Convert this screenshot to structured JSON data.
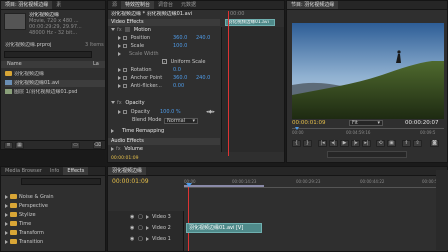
{
  "project": {
    "tabs": [
      "项目: 羽化视频边缘",
      "素"
    ],
    "clip_title": "羽化视频边缘",
    "clip_info": [
      "Movie, 720 x 480 ...",
      "00:00:29:29, 29.97...",
      "48000 Hz - 32 bit..."
    ],
    "project_file": "羽化视频边缘.prproj",
    "items_count": "3 Items",
    "column_name": "Name",
    "column_label": "La",
    "items": [
      {
        "name": "羽化视频边缘",
        "type": "folder"
      },
      {
        "name": "羽化视频边缘01.avi",
        "type": "clip"
      },
      {
        "name": "图层 1/羽化视频边缘01.psd",
        "type": "image"
      }
    ]
  },
  "effect_controls": {
    "tabs": [
      "源",
      "特效控制台",
      "调音台",
      "元数据"
    ],
    "sequence_clip": "羽化视频边缘 * 羽化视频边缘01.avi",
    "timecode_head": "00:00",
    "clip_chip": "羽化视频边缘01.avi",
    "section_video": "Video Effects",
    "motion": "Motion",
    "position_label": "Position",
    "position_x": "360.0",
    "position_y": "240.0",
    "scale_label": "Scale",
    "scale_value": "100.0",
    "scale_width_label": "Scale Width",
    "uniform_scale": "Uniform Scale",
    "rotation_label": "Rotation",
    "rotation_value": "0.0",
    "anchor_label": "Anchor Point",
    "anchor_x": "360.0",
    "anchor_y": "240.0",
    "antiflicker_label": "Anti-flicker...",
    "antiflicker_value": "0.00",
    "opacity_section": "Opacity",
    "opacity_label": "Opacity",
    "opacity_value": "100.0 %",
    "blend_label": "Blend Mode",
    "blend_value": "Normal",
    "time_remapping": "Time Remapping",
    "section_audio": "Audio Effects",
    "volume": "Volume",
    "footer_timecode": "00:00:01:09"
  },
  "program": {
    "tabs": [
      "节目: 羽化视频边缘"
    ],
    "timecode": "00:00:01:09",
    "fit": "Fit",
    "duration": "00:00:20:07",
    "ruler_start": "00:00",
    "ruler_mid": "00:04:59:16",
    "ruler_end": "00:09:5"
  },
  "effects": {
    "tabs": [
      "Media Browser",
      "Info",
      "Effects"
    ],
    "items": [
      "Noise & Grain",
      "Perspective",
      "Stylize",
      "Time",
      "Transform",
      "Transition"
    ]
  },
  "timeline": {
    "tabs": [
      "羽化视频边缘"
    ],
    "timecode": "00:00:01:09",
    "ruler": [
      "00:00",
      "00:00:14:23",
      "00:00:29:23",
      "00:00:44:22",
      "00:00:59:22"
    ],
    "tracks": [
      {
        "name": "Video 3",
        "clip": ""
      },
      {
        "name": "Video 2",
        "clip": "羽化视频边缘01.avi [V]"
      },
      {
        "name": "Video 1",
        "clip": ""
      }
    ]
  },
  "colors": {
    "accent_blue": "#4f9be8",
    "timecode_yellow": "#e7c04a",
    "clip": "#4f8a8a",
    "playhead": "#dd3333"
  }
}
